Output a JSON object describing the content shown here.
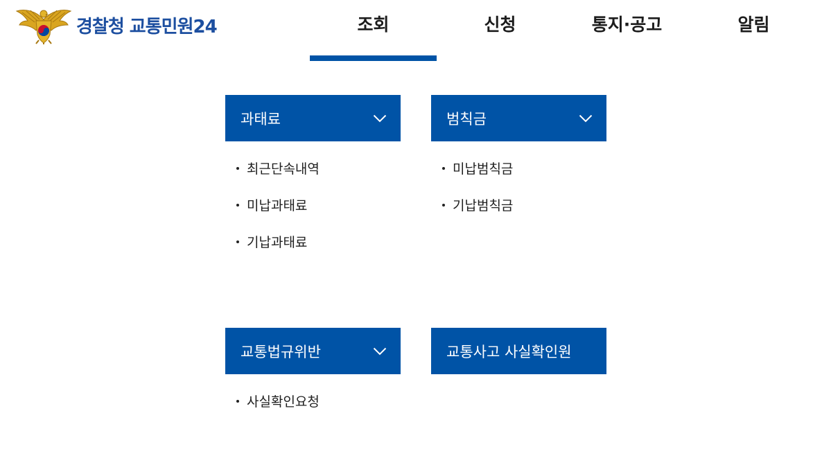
{
  "header": {
    "logo_text": "경찰청 교통민원24",
    "logo_icon": "police-emblem-icon",
    "nav": [
      {
        "label": "조회",
        "active": true
      },
      {
        "label": "신청",
        "active": false
      },
      {
        "label": "통지·공고",
        "active": false
      },
      {
        "label": "알림",
        "active": false
      }
    ]
  },
  "menus": [
    {
      "title": "과태료",
      "icon": "chevron-down-icon",
      "items": [
        "최근단속내역",
        "미납과태료",
        "기납과태료"
      ]
    },
    {
      "title": "범칙금",
      "icon": "chevron-down-icon",
      "items": [
        "미납범칙금",
        "기납범칙금"
      ]
    },
    {
      "title": "교통법규위반",
      "icon": "chevron-down-icon",
      "items": [
        "사실확인요청"
      ]
    },
    {
      "title": "교통사고 사실확인원",
      "items": []
    }
  ],
  "colors": {
    "primary": "#0053a6",
    "logo_text": "#1d4fa0",
    "nav_text": "#1c1c1c"
  }
}
